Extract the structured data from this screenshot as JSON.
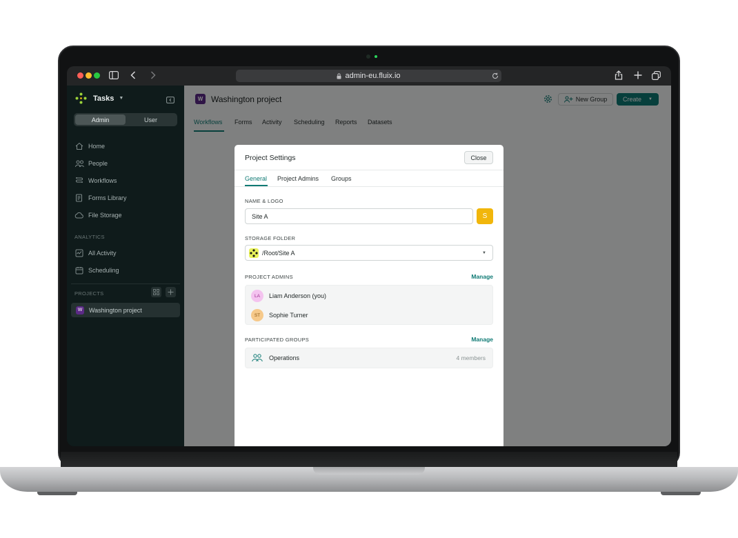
{
  "browser": {
    "url": "admin-eu.fluix.io"
  },
  "sidebar": {
    "workspace_label": "Tasks",
    "mode_tabs": [
      "Admin",
      "User"
    ],
    "nav_items": [
      {
        "label": "Home",
        "icon": "home-icon"
      },
      {
        "label": "People",
        "icon": "people-icon"
      },
      {
        "label": "Workflows",
        "icon": "workflows-icon"
      },
      {
        "label": "Forms Library",
        "icon": "forms-library-icon"
      },
      {
        "label": "File Storage",
        "icon": "cloud-icon"
      }
    ],
    "analytics_section": "ANALYTICS",
    "analytics_items": [
      {
        "label": "All Activity",
        "icon": "activity-icon"
      },
      {
        "label": "Scheduling",
        "icon": "calendar-icon"
      }
    ],
    "projects_section": "PROJECTS",
    "projects": [
      {
        "badge": "W",
        "label": "Washington project"
      }
    ]
  },
  "header": {
    "project_badge": "W",
    "project_title": "Washington project",
    "new_group_label": "New Group",
    "create_label": "Create",
    "tabs": [
      "Workflows",
      "Forms",
      "Activity",
      "Scheduling",
      "Reports",
      "Datasets"
    ],
    "active_tab": "Workflows"
  },
  "modal": {
    "title": "Project Settings",
    "close_label": "Close",
    "tabs": [
      "General",
      "Project Admins",
      "Groups"
    ],
    "active_tab": "General",
    "name_logo_label": "NAME & LOGO",
    "name_value": "Site A",
    "logo_letter": "S",
    "storage_label": "STORAGE FOLDER",
    "storage_value": "/Root/Site A",
    "admins_label": "PROJECT ADMINS",
    "manage_label": "Manage",
    "admins": [
      {
        "initials": "LA",
        "name": "Liam Anderson (you)",
        "color": "#f4c3ef",
        "text_color": "#9c2a90"
      },
      {
        "initials": "ST",
        "name": "Sophie Turner",
        "color": "#f6c98a",
        "text_color": "#8a5410"
      }
    ],
    "groups_label": "PARTICIPATED GROUPS",
    "groups": [
      {
        "name": "Operations",
        "members": "4 members"
      }
    ]
  },
  "colors": {
    "accent": "#0f7a74",
    "sidebar_bg": "#0f1b1b",
    "project_badge": "#5b2a86",
    "logo": "#f1b60b"
  }
}
